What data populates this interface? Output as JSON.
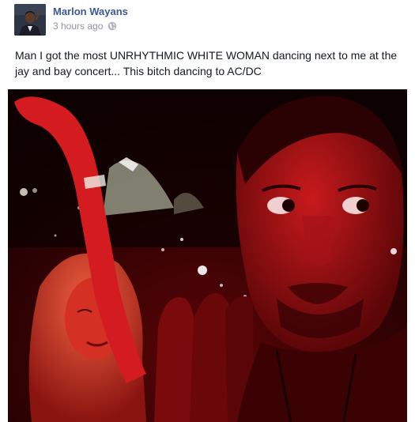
{
  "post": {
    "author": "Marlon Wayans",
    "timestamp": "3 hours ago",
    "privacy_icon": "globe-icon",
    "text": "Man I got the most UNRHYTHMIC WHITE WOMAN dancing next to me at the jay and bay concert... This bitch dancing to AC/DC"
  },
  "colors": {
    "author_link": "#3b5998",
    "meta_text": "#90949c",
    "body_text": "#141823",
    "photo_tint": "#c4141a"
  }
}
